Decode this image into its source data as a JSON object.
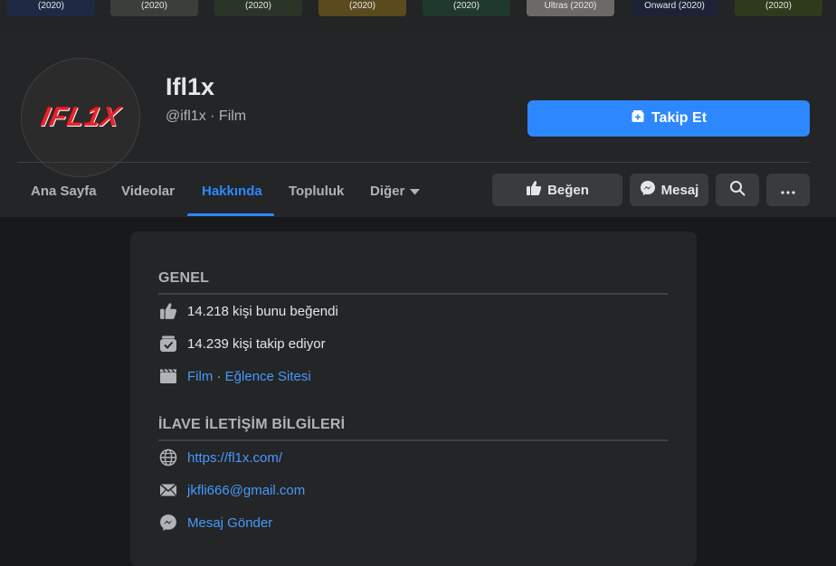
{
  "cover": {
    "posters": [
      {
        "label": "(2020)",
        "color": "#1e2a44"
      },
      {
        "label": "(2020)",
        "color": "#3a3f3a"
      },
      {
        "label": "(2020)",
        "color": "#2a3528"
      },
      {
        "label": "(2020)",
        "color": "#5a4a1e"
      },
      {
        "label": "(2020)",
        "color": "#1f3a2c"
      },
      {
        "label": "Ultras (2020)",
        "color": "#6b6a66"
      },
      {
        "label": "Onward (2020)",
        "color": "#1d2337"
      },
      {
        "label": "(2020)",
        "color": "#2f3a1c"
      }
    ]
  },
  "profile": {
    "logo_text": "IFL1X",
    "name": "Ifl1x",
    "handle": "@ifl1x · Film",
    "follow_label": "Takip Et"
  },
  "tabs": [
    {
      "label": "Ana Sayfa"
    },
    {
      "label": "Videolar"
    },
    {
      "label": "Hakkında",
      "active": true
    },
    {
      "label": "Topluluk"
    },
    {
      "label": "Diğer"
    }
  ],
  "actions": {
    "like_label": "Beğen",
    "message_label": "Mesaj"
  },
  "about": {
    "general_title": "GENEL",
    "likes_text": "14.218 kişi bunu beğendi",
    "follows_text": "14.239 kişi takip ediyor",
    "category_1": "Film",
    "category_sep": " · ",
    "category_2": "Eğlence Sitesi",
    "contact_title": "İLAVE İLETİŞİM BİLGİLERİ",
    "website": "https://fl1x.com/",
    "email": "jkfli666@gmail.com",
    "send_message": "Mesaj Gönder"
  },
  "colors": {
    "accent": "#2d88ff",
    "link": "#4599ff",
    "background": "#18191a",
    "surface": "#242526"
  }
}
